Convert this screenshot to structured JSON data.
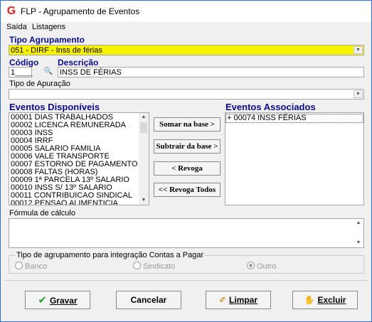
{
  "window": {
    "title": "FLP - Agrupamento de Eventos",
    "app_icon_glyph": "G"
  },
  "menu": {
    "items": [
      "Saída",
      "Listagens"
    ]
  },
  "tipo_agrupamento": {
    "label": "Tipo Agrupamento",
    "value": "051 - DIRF - Inss de férias",
    "highlight_color": "#f9f200"
  },
  "codigo": {
    "label": "Código",
    "value": "1"
  },
  "descricao": {
    "label": "Descrição",
    "value": "INSS DE FÉRIAS"
  },
  "tipo_apuracao": {
    "label": "Tipo de Apuração",
    "value": ""
  },
  "eventos_disponiveis": {
    "label": "Eventos Disponíveis",
    "items": [
      "00001 DIAS TRABALHADOS",
      "00002 LICENCA REMUNERADA",
      "00003 INSS",
      "00004 IRRF",
      "00005 SALARIO FAMILIA",
      "00006 VALE TRANSPORTE",
      "00007 ESTORNO DE PAGAMENTO",
      "00008 FALTAS (HORAS)",
      "00009 1ª PARCELA 13º SALARIO",
      "00010 INSS S/ 13º SALARIO",
      "00011 CONTRIBUICAO SINDICAL",
      "00012 PENSAO ALIMENTICIA"
    ]
  },
  "eventos_associados": {
    "label": "Eventos Associados",
    "items": [
      "+ 00074 INSS FÉRIAS"
    ]
  },
  "action_buttons": {
    "somar": "Somar  na base >",
    "subtrair": "Subtrair da base >",
    "revoga": "< Revoga",
    "revoga_todos": "<< Revoga Todos"
  },
  "formula": {
    "label": "Fórmula de cálculo",
    "value": ""
  },
  "integracao": {
    "label": "Tipo de agrupamento para integração Contas a Pagar",
    "options": [
      {
        "label": "Banco",
        "selected": false
      },
      {
        "label": "Sindicato",
        "selected": false
      },
      {
        "label": "Outro",
        "selected": true
      }
    ]
  },
  "bottom_buttons": {
    "gravar": "Gravar",
    "cancelar": "Cancelar",
    "limpar": "Limpar",
    "excluir": "Excluir"
  },
  "colors": {
    "frame_border": "#2f6fd0",
    "label_blue": "#0a0a8a",
    "gravar_check": "#2aa52a"
  }
}
